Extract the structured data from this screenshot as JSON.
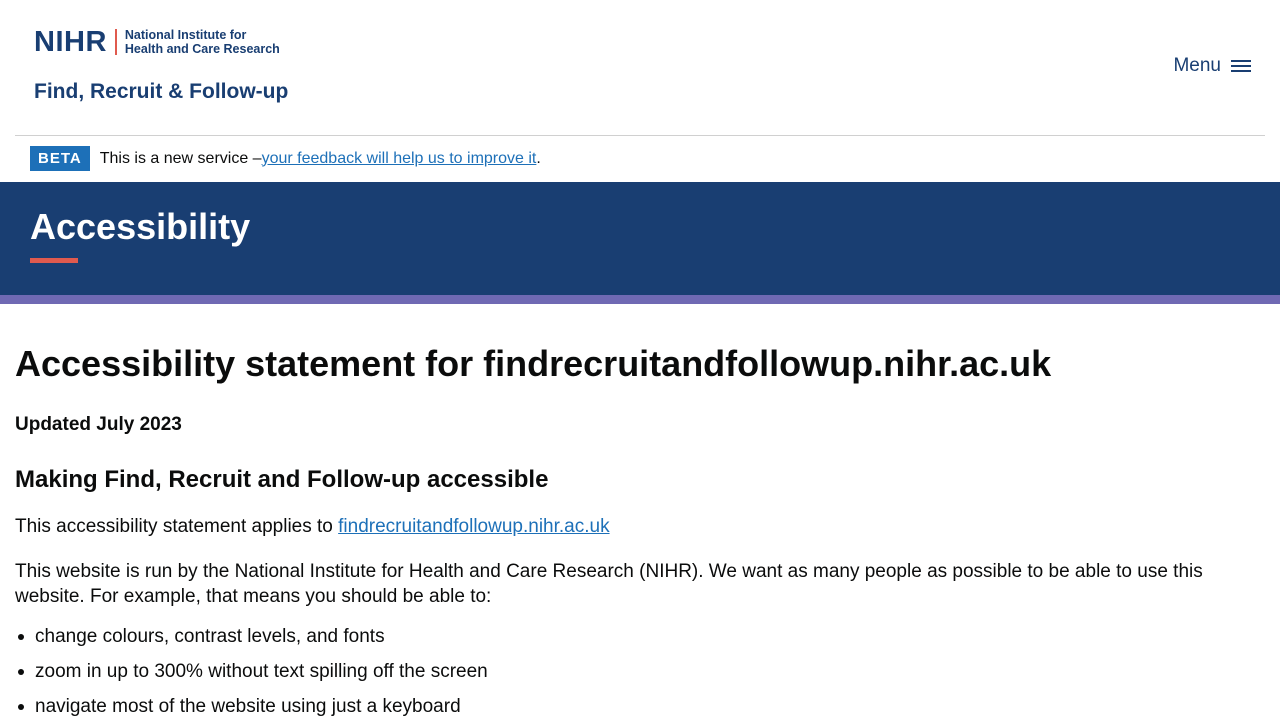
{
  "header": {
    "logo": {
      "org_short": "NIHR",
      "tagline_line1": "National Institute for",
      "tagline_line2": "Health and Care Research"
    },
    "service_name": "Find, Recruit & Follow-up",
    "menu_label": "Menu",
    "menu_icon": "hamburger-icon"
  },
  "beta_banner": {
    "tag": "BETA",
    "text": "This is a new service – ",
    "link_text": "your feedback will help us to improve it",
    "suffix": "."
  },
  "hero": {
    "title": "Accessibility"
  },
  "main": {
    "heading": "Accessibility statement for findrecruitandfollowup.nihr.ac.uk",
    "updated": "Updated July 2023",
    "section_heading": "Making Find, Recruit and Follow-up accessible",
    "intro_text": "This accessibility statement applies to ",
    "intro_link": "findrecruitandfollowup.nihr.ac.uk",
    "body_text": "This website is run by the National Institute for Health and Care Research (NIHR). We want as many people as possible to be able to use this website. For example, that means you should be able to:",
    "list_items": [
      "change colours, contrast levels, and fonts",
      "zoom in up to 300% without text spilling off the screen",
      "navigate most of the website using just a keyboard"
    ]
  },
  "colors": {
    "brand_navy": "#193e72",
    "accent_red": "#e05a4e",
    "stripe_purple": "#6f69b3",
    "link_blue": "#1d70b8"
  }
}
